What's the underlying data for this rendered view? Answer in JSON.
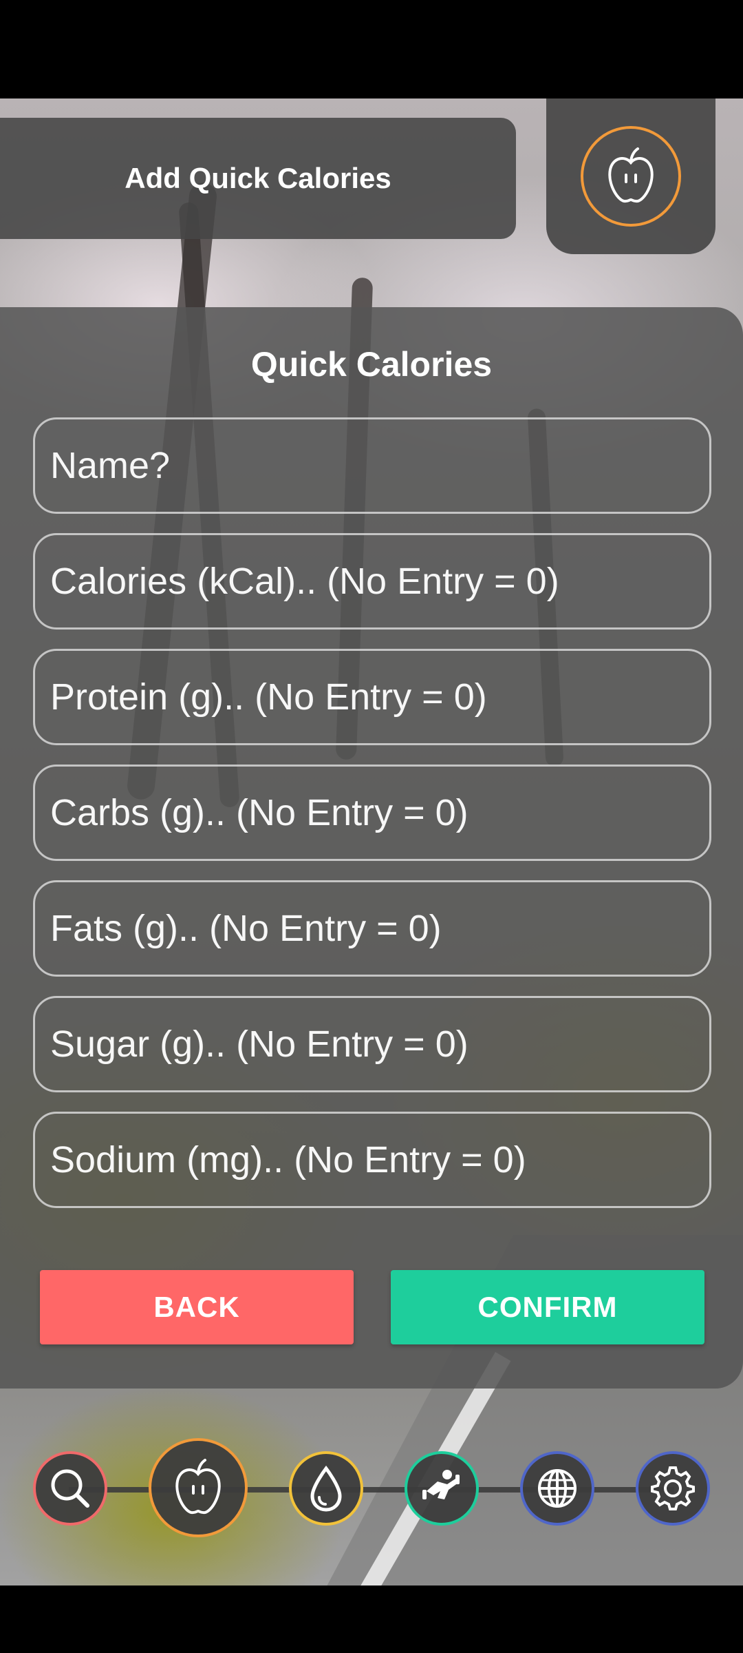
{
  "header": {
    "title": "Add Quick Calories",
    "icon": "apple-icon",
    "accent_color": "#f29a3a"
  },
  "form": {
    "title": "Quick Calories",
    "fields": [
      {
        "placeholder": "Name?",
        "value": ""
      },
      {
        "placeholder": "Calories (kCal).. (No Entry = 0)",
        "value": ""
      },
      {
        "placeholder": "Protein (g).. (No Entry = 0)",
        "value": ""
      },
      {
        "placeholder": "Carbs (g).. (No Entry = 0)",
        "value": ""
      },
      {
        "placeholder": "Fats (g).. (No Entry = 0)",
        "value": ""
      },
      {
        "placeholder": "Sugar (g).. (No Entry = 0)",
        "value": ""
      },
      {
        "placeholder": "Sodium (mg).. (No Entry = 0)",
        "value": ""
      }
    ],
    "back_label": "BACK",
    "confirm_label": "CONFIRM",
    "back_color": "#ff6767",
    "confirm_color": "#1ece9c"
  },
  "bottom_nav": {
    "items": [
      {
        "icon": "search-icon",
        "color": "#f06a6a"
      },
      {
        "icon": "apple-icon",
        "color": "#f29a3a",
        "active": true
      },
      {
        "icon": "water-drop-icon",
        "color": "#f2c23a"
      },
      {
        "icon": "workout-icon",
        "color": "#1ece9c"
      },
      {
        "icon": "globe-icon",
        "color": "#4f66c9"
      },
      {
        "icon": "gear-icon",
        "color": "#4f66c9"
      }
    ]
  }
}
